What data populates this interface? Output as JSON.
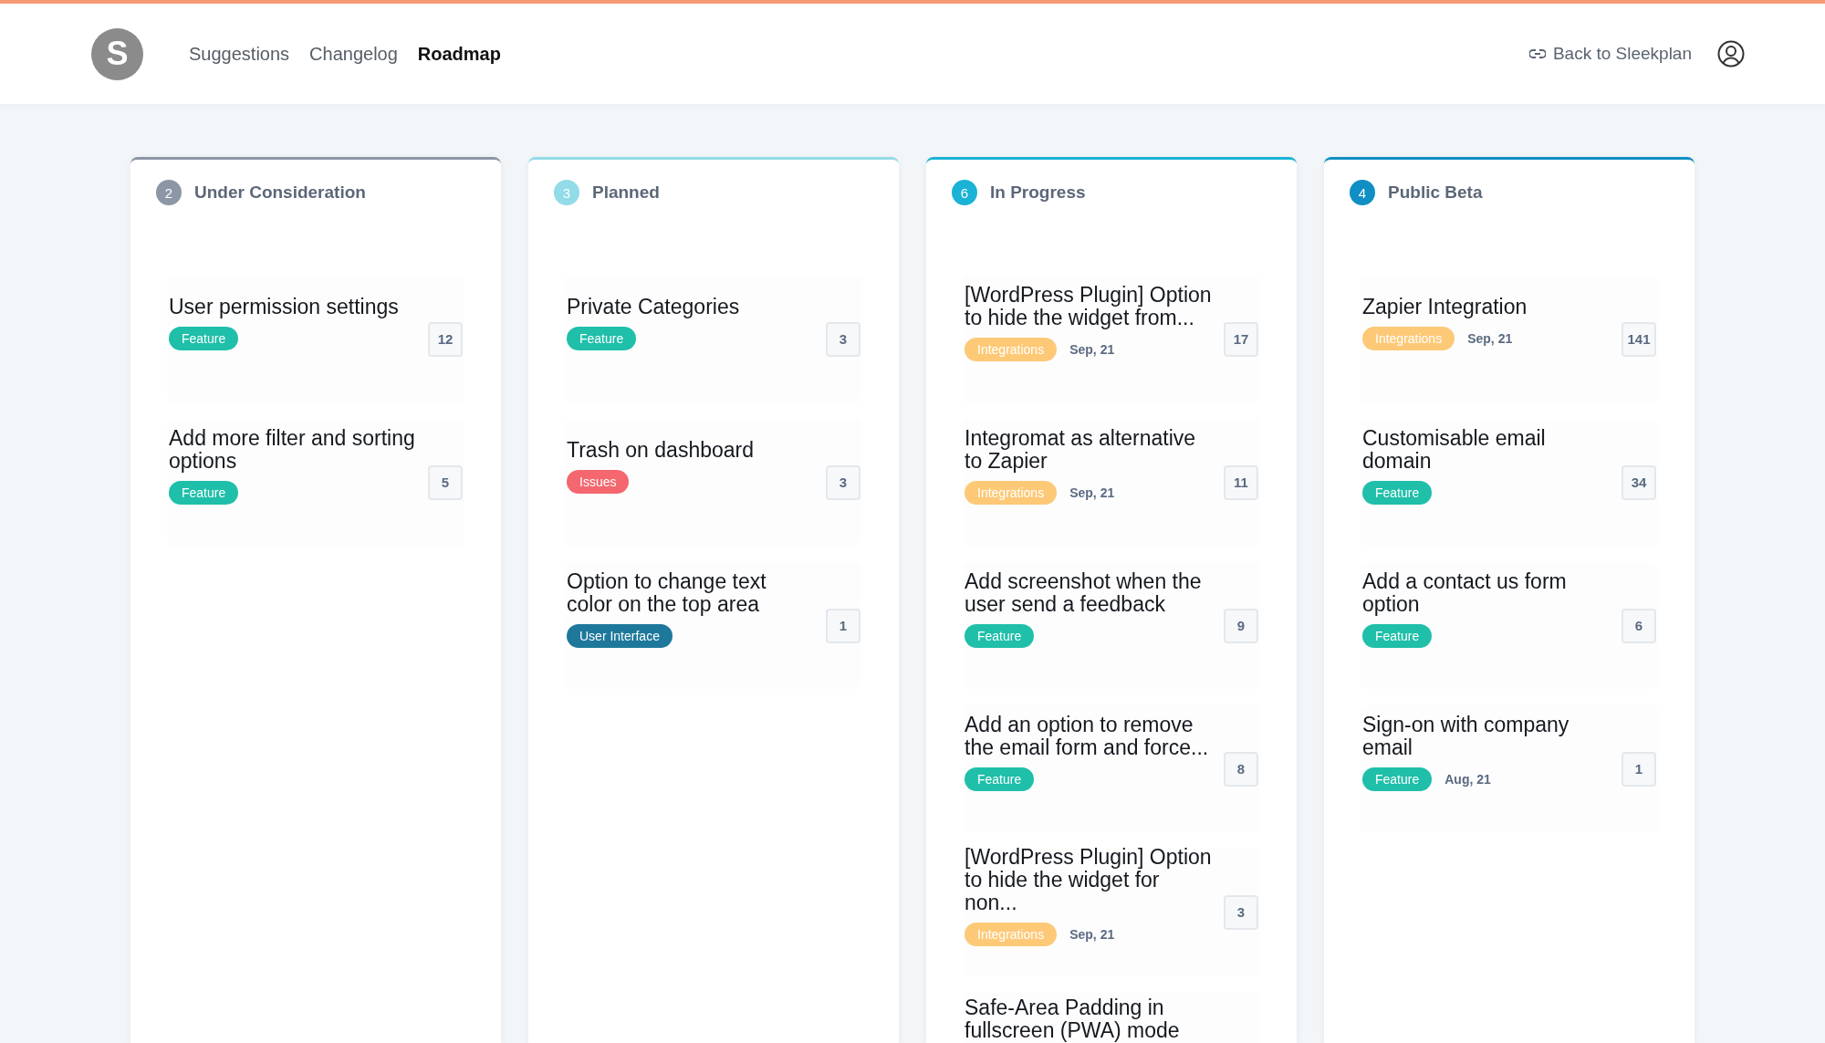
{
  "header": {
    "logo_letter": "S",
    "nav": [
      {
        "label": "Suggestions",
        "selected": false
      },
      {
        "label": "Changelog",
        "selected": false
      },
      {
        "label": "Roadmap",
        "selected": true
      }
    ],
    "back_link": "Back to Sleekplan"
  },
  "columns": [
    {
      "title": "Under Consideration",
      "count": "2",
      "color": "#8c96a5",
      "cards": [
        {
          "title": "User permission settings",
          "tag": {
            "label": "Feature",
            "color": "#1fbfa9"
          },
          "votes": "12"
        },
        {
          "title": "Add more filter and sorting options",
          "tag": {
            "label": "Feature",
            "color": "#1fbfa9"
          },
          "votes": "5"
        }
      ]
    },
    {
      "title": "Planned",
      "count": "3",
      "color": "#92dbe8",
      "cards": [
        {
          "title": "Private Categories",
          "tag": {
            "label": "Feature",
            "color": "#1fbfa9"
          },
          "votes": "3"
        },
        {
          "title": "Trash on dashboard",
          "tag": {
            "label": "Issues",
            "color": "#f4676e"
          },
          "votes": "3"
        },
        {
          "title": "Option to change text color on the top area",
          "tag": {
            "label": "User Interface",
            "color": "#1e789b"
          },
          "votes": "1"
        }
      ]
    },
    {
      "title": "In Progress",
      "count": "6",
      "color": "#1ab3d5",
      "cards": [
        {
          "title": "[WordPress Plugin] Option to hide the widget from...",
          "tag": {
            "label": "Integrations",
            "color": "#fdc977"
          },
          "date": "Sep, 21",
          "votes": "17"
        },
        {
          "title": "Integromat as alternative to Zapier",
          "tag": {
            "label": "Integrations",
            "color": "#fdc977"
          },
          "date": "Sep, 21",
          "votes": "11"
        },
        {
          "title": "Add screenshot when the user send a feedback",
          "tag": {
            "label": "Feature",
            "color": "#1fbfa9"
          },
          "votes": "9"
        },
        {
          "title": "Add an option to remove the email form and force...",
          "tag": {
            "label": "Feature",
            "color": "#1fbfa9"
          },
          "votes": "8"
        },
        {
          "title": "[WordPress Plugin] Option to hide the widget for non...",
          "tag": {
            "label": "Integrations",
            "color": "#fdc977"
          },
          "date": "Sep, 21",
          "votes": "3"
        },
        {
          "title": "Safe-Area Padding in fullscreen (PWA) mode"
        }
      ]
    },
    {
      "title": "Public Beta",
      "count": "4",
      "color": "#0f8fc3",
      "cards": [
        {
          "title": "Zapier Integration",
          "tag": {
            "label": "Integrations",
            "color": "#fdc977"
          },
          "date": "Sep, 21",
          "votes": "141"
        },
        {
          "title": "Customisable email domain",
          "tag": {
            "label": "Feature",
            "color": "#1fbfa9"
          },
          "votes": "34"
        },
        {
          "title": "Add a contact us form option",
          "tag": {
            "label": "Feature",
            "color": "#1fbfa9"
          },
          "votes": "6"
        },
        {
          "title": "Sign-on with company email",
          "tag": {
            "label": "Feature",
            "color": "#1fbfa9"
          },
          "date": "Aug, 21",
          "votes": "1"
        }
      ]
    }
  ]
}
